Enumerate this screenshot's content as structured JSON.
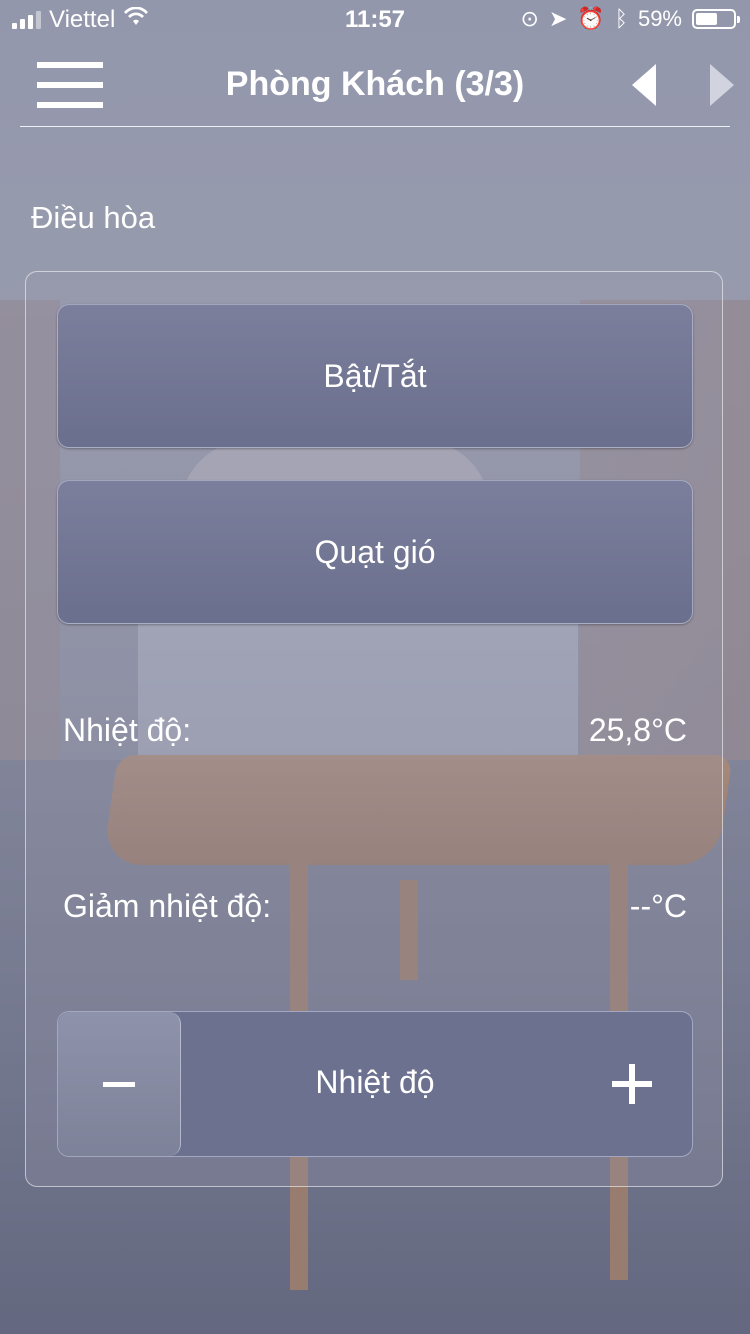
{
  "status_bar": {
    "carrier": "Viettel",
    "time": "11:57",
    "battery_percent": "59%",
    "battery_level": 0.59
  },
  "header": {
    "title": "Phòng Khách (3/3)"
  },
  "section": {
    "label": "Điều hòa"
  },
  "controls": {
    "power_label": "Bật/Tắt",
    "fan_label": "Quạt gió",
    "temperature_label": "Nhiệt độ:",
    "temperature_value": "25,8°C",
    "setpoint_label": "Giảm nhiệt độ:",
    "setpoint_value": "--°C",
    "stepper_label": "Nhiệt độ"
  },
  "colors": {
    "button_fill": "#6c7190",
    "text": "#ffffff"
  }
}
